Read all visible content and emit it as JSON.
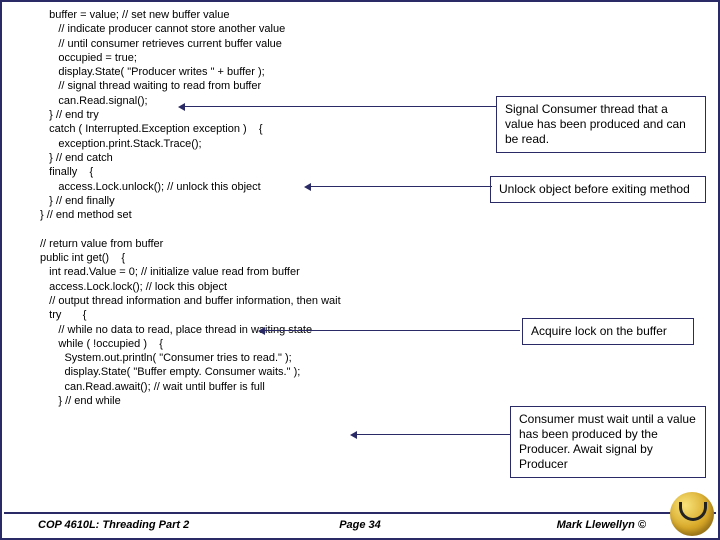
{
  "code": {
    "l1": "   buffer = value; // set new buffer value",
    "l2": "      // indicate producer cannot store another value",
    "l3": "      // until consumer retrieves current buffer value",
    "l4": "      occupied = true;",
    "l5": "      display.State( \"Producer writes \" + buffer );",
    "l6": "      // signal thread waiting to read from buffer",
    "l7": "      can.Read.signal();",
    "l8": "   } // end try",
    "l9": "   catch ( Interrupted.Exception exception )    {",
    "l10": "      exception.print.Stack.Trace();",
    "l11": "   } // end catch",
    "l12": "   finally    {",
    "l13": "      access.Lock.unlock(); // unlock this object",
    "l14": "   } // end finally",
    "l15": "} // end method set",
    "l16": " ",
    "l17": "// return value from buffer",
    "l18": "public int get()    {",
    "l19": "   int read.Value = 0; // initialize value read from buffer",
    "l20": "   access.Lock.lock(); // lock this object",
    "l21": "   // output thread information and buffer information, then wait",
    "l22": "   try       {",
    "l23": "      // while no data to read, place thread in waiting state",
    "l24": "      while ( !occupied )    {",
    "l25": "        System.out.println( \"Consumer tries to read.\" );",
    "l26": "        display.State( \"Buffer empty. Consumer waits.\" );",
    "l27": "        can.Read.await(); // wait until buffer is full",
    "l28": "      } // end while"
  },
  "callouts": {
    "c1": "Signal Consumer thread that a value has been produced and can be read.",
    "c2": "Unlock object before exiting method",
    "c3": "Acquire lock on the buffer",
    "c4": "Consumer must wait until a value has been produced by the Producer. Await signal by Producer"
  },
  "footer": {
    "left": "COP 4610L: Threading Part 2",
    "center": "Page 34",
    "right": "Mark Llewellyn ©"
  }
}
